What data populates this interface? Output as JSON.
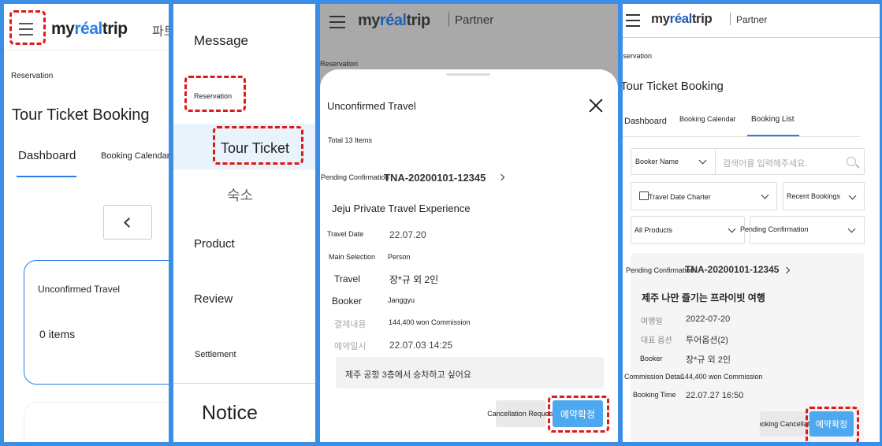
{
  "brand": {
    "logo_prefix": "my",
    "logo_accent": "réal",
    "logo_suffix": "trip",
    "partner_label": "Partner",
    "partner_label_kr": "파트"
  },
  "colors": {
    "accent": "#2b7de9",
    "frame": "#3a8ee6",
    "highlight": "#e01818",
    "confirm": "#4da8f0"
  },
  "icons": {
    "menu": "hamburger-icon",
    "close": "close-icon",
    "search": "search-icon",
    "calendar": "calendar-icon"
  },
  "screen1": {
    "breadcrumb": "Reservation",
    "title": "Tour Ticket Booking",
    "tabs": [
      "Dashboard",
      "Booking Calendar"
    ],
    "card_title": "Unconfirmed Travel",
    "card_count": "0 items"
  },
  "screen2": {
    "menu": {
      "message": "Message",
      "reservation": "Reservation",
      "tour_ticket": "Tour Ticket",
      "lodging": "숙소",
      "product": "Product",
      "review": "Review",
      "settlement": "Settlement",
      "notice": "Notice"
    }
  },
  "screen3": {
    "breadcrumb": "Reservation",
    "sheet_title": "Unconfirmed Travel",
    "total": "Total 13 Items",
    "status": "Pending Confirmation",
    "booking_no": "TNA-20200101-12345",
    "product_name": "Jeju Private Travel Experience",
    "rows": [
      {
        "label": "Travel Date",
        "value": "22.07.20"
      },
      {
        "label": "Main Selection",
        "value": "Person"
      },
      {
        "label": "Travel",
        "value": "장*규 외 2인"
      },
      {
        "label": "Booker",
        "value": "Janggyu"
      },
      {
        "label": "결제내용",
        "value": "144,400 won Commission"
      },
      {
        "label": "예약일시",
        "value": "22.07.03 14:25"
      }
    ],
    "request_note": "제주 공항 3층에서 승차하고 싶어요",
    "cancel_label": "Cancellation Request",
    "confirm_label": "예약확정"
  },
  "screen4": {
    "breadcrumb": "Reservation",
    "title": "Tour Ticket Booking",
    "tabs": [
      "Dashboard",
      "Booking Calendar",
      "Booking List"
    ],
    "search_type": "Booker Name",
    "search_placeholder": "검색어를 입력해주세요.",
    "date_filter": "Travel Date Charter",
    "sort_filter": "Recent Bookings",
    "product_filter": "All Products",
    "status_filter": "Pending Confirmation",
    "status": "Pending Confirmation",
    "booking_no": "TNA-20200101-12345",
    "product_name": "제주 나만 즐기는 프라이빗 여행",
    "rows": [
      {
        "label": "여행일",
        "value": "2022-07-20"
      },
      {
        "label": "대표 옵션",
        "value": "투어옵션(2)"
      },
      {
        "label": "Booker",
        "value": "장*규 외 2인"
      },
      {
        "label": "Commission Details",
        "value": "144,400 won Commission"
      },
      {
        "label": "Booking Time",
        "value": "22.07.27 16:50"
      }
    ],
    "cancel_label": "Booking Cancellation",
    "confirm_label": "예약확정"
  }
}
